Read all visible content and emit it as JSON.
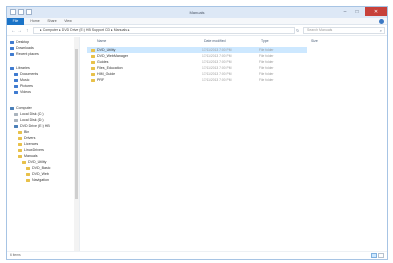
{
  "window": {
    "title": "Manuals",
    "minimize_glyph": "–",
    "maximize_glyph": "□",
    "close_glyph": "✕"
  },
  "ribbon": {
    "tabs": [
      "File",
      "Home",
      "Share",
      "View"
    ]
  },
  "address": {
    "back_glyph": "←",
    "forward_glyph": "→",
    "up_glyph": "↑",
    "path": "▸ Computer ▸ DVD Drive (E:) HB Support CD ▸ Manuals ▸",
    "refresh_glyph": "↻",
    "search_placeholder": "Search Manuals",
    "search_icon_glyph": "⌕"
  },
  "navpane": {
    "items": [
      {
        "label": "Desktop",
        "icon": "desktop-icon"
      },
      {
        "label": "Downloads",
        "icon": "downloads-icon"
      },
      {
        "label": "Recent places",
        "icon": "recent-places-icon"
      },
      {
        "label": "Libraries",
        "icon": "libraries-icon"
      },
      {
        "label": "Documents",
        "icon": "documents-icon"
      },
      {
        "label": "Music",
        "icon": "music-icon"
      },
      {
        "label": "Pictures",
        "icon": "pictures-icon"
      },
      {
        "label": "Videos",
        "icon": "videos-icon"
      },
      {
        "label": "Computer",
        "icon": "computer-icon"
      },
      {
        "label": "Local Disk (C:)",
        "icon": "drive-icon"
      },
      {
        "label": "Local Disk (D:)",
        "icon": "drive-icon"
      },
      {
        "label": "DVD Drive (E:) HB",
        "icon": "dvd-drive-icon"
      },
      {
        "label": "Bin",
        "icon": "folder-icon"
      },
      {
        "label": "Drivers",
        "icon": "folder-icon"
      },
      {
        "label": "Licences",
        "icon": "folder-icon"
      },
      {
        "label": "LinuxDrivers",
        "icon": "folder-icon"
      },
      {
        "label": "Manuals",
        "icon": "folder-icon"
      },
      {
        "label": "DVD_Utility",
        "icon": "folder-icon"
      },
      {
        "label": "DVD_Basic",
        "icon": "folder-icon"
      },
      {
        "label": "DVD_Web",
        "icon": "folder-icon"
      },
      {
        "label": "Navigation",
        "icon": "folder-icon"
      }
    ]
  },
  "columns": {
    "name": "Name",
    "date_modified": "Date modified",
    "type": "Type",
    "size": "Size"
  },
  "files": [
    {
      "name": "DVD_Utility",
      "date": "17/11/2013 7:00 PM",
      "type": "File folder",
      "selected": true
    },
    {
      "name": "DVD_WebManager",
      "date": "17/11/2013 7:00 PM",
      "type": "File folder",
      "selected": false
    },
    {
      "name": "Guides",
      "date": "17/11/2013 7:00 PM",
      "type": "File folder",
      "selected": false
    },
    {
      "name": "Files_Education",
      "date": "17/11/2013 7:00 PM",
      "type": "File folder",
      "selected": false
    },
    {
      "name": "HIM_Guide",
      "date": "17/11/2013 7:00 PM",
      "type": "File folder",
      "selected": false
    },
    {
      "name": "PRF",
      "date": "17/11/2013 7:00 PM",
      "type": "File folder",
      "selected": false
    }
  ],
  "status": {
    "text": "6 items"
  },
  "colors": {
    "accent": "#1a73c7",
    "selection": "#cde8ff",
    "close": "#c7413a",
    "folder": "#e8c14a"
  }
}
